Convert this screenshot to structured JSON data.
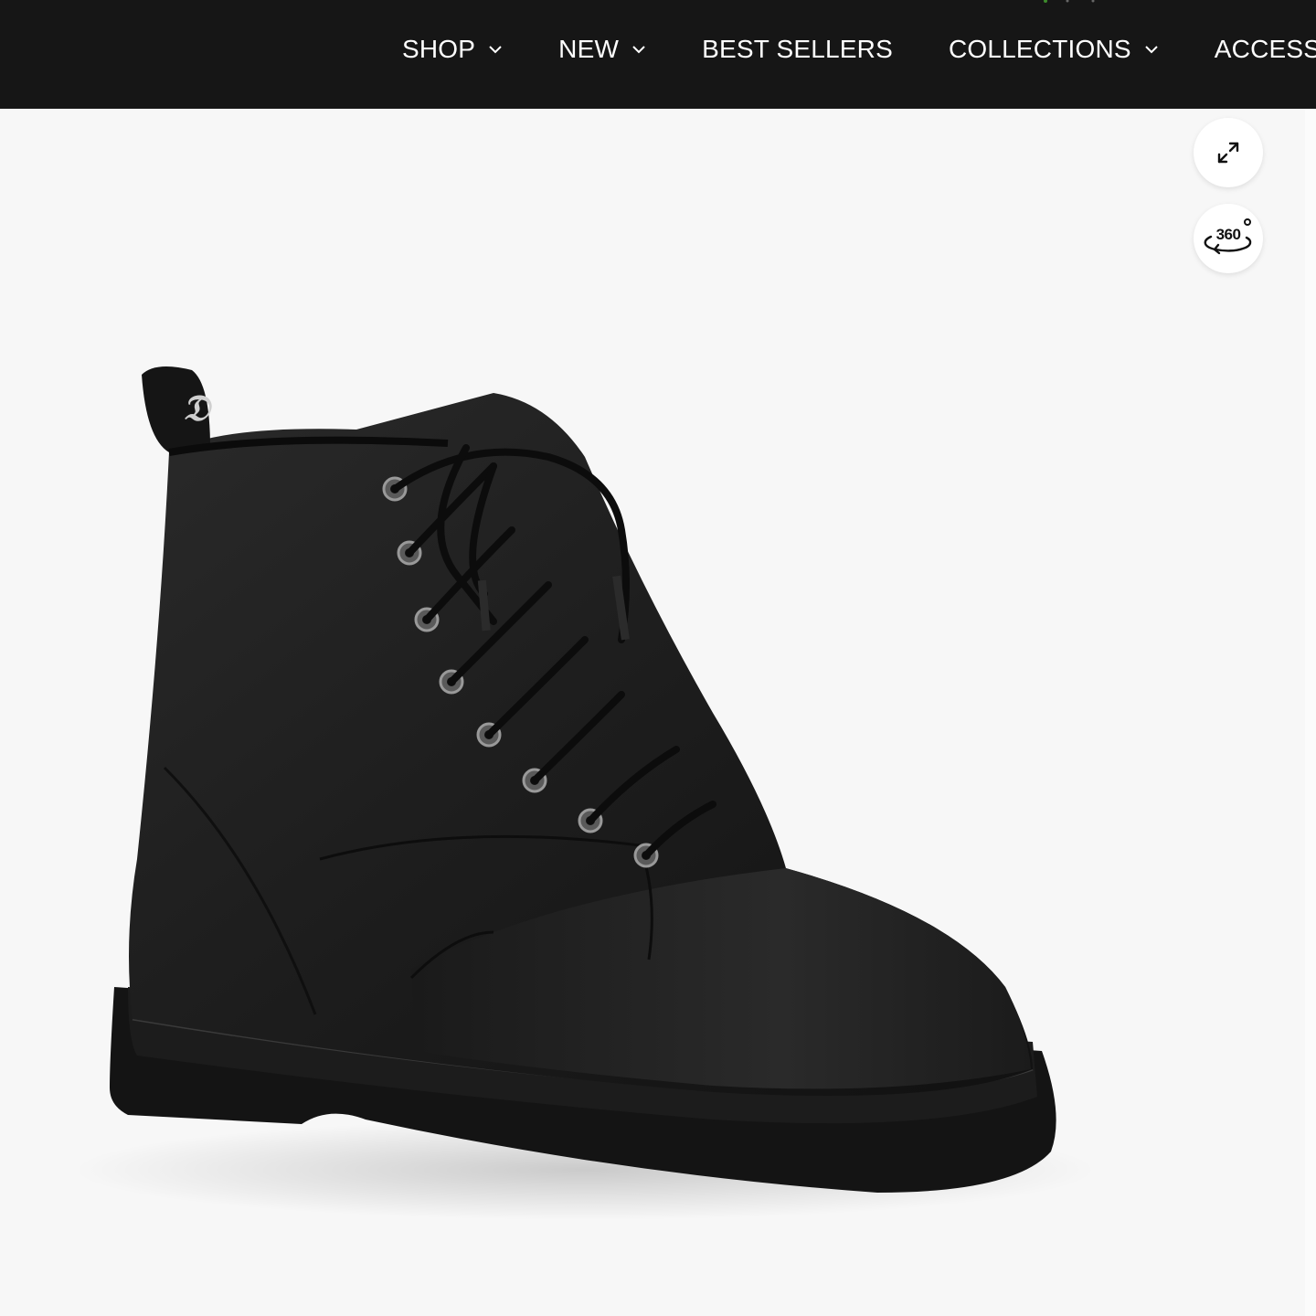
{
  "nav": {
    "items": [
      {
        "label": "SHOP",
        "has_dropdown": true
      },
      {
        "label": "NEW",
        "has_dropdown": true
      },
      {
        "label": "BEST SELLERS",
        "has_dropdown": false
      },
      {
        "label": "COLLECTIONS",
        "has_dropdown": true
      },
      {
        "label": "ACCESSORIES",
        "has_dropdown": false
      }
    ]
  },
  "gallery": {
    "expand_icon": "expand-icon",
    "view360_label": "360",
    "view360_icon": "rotate-360-icon",
    "product_image": "black-lace-up-combat-boot"
  },
  "colors": {
    "nav_bg": "#161616",
    "nav_text": "#ffffff",
    "page_bg": "#f7f7f7"
  }
}
